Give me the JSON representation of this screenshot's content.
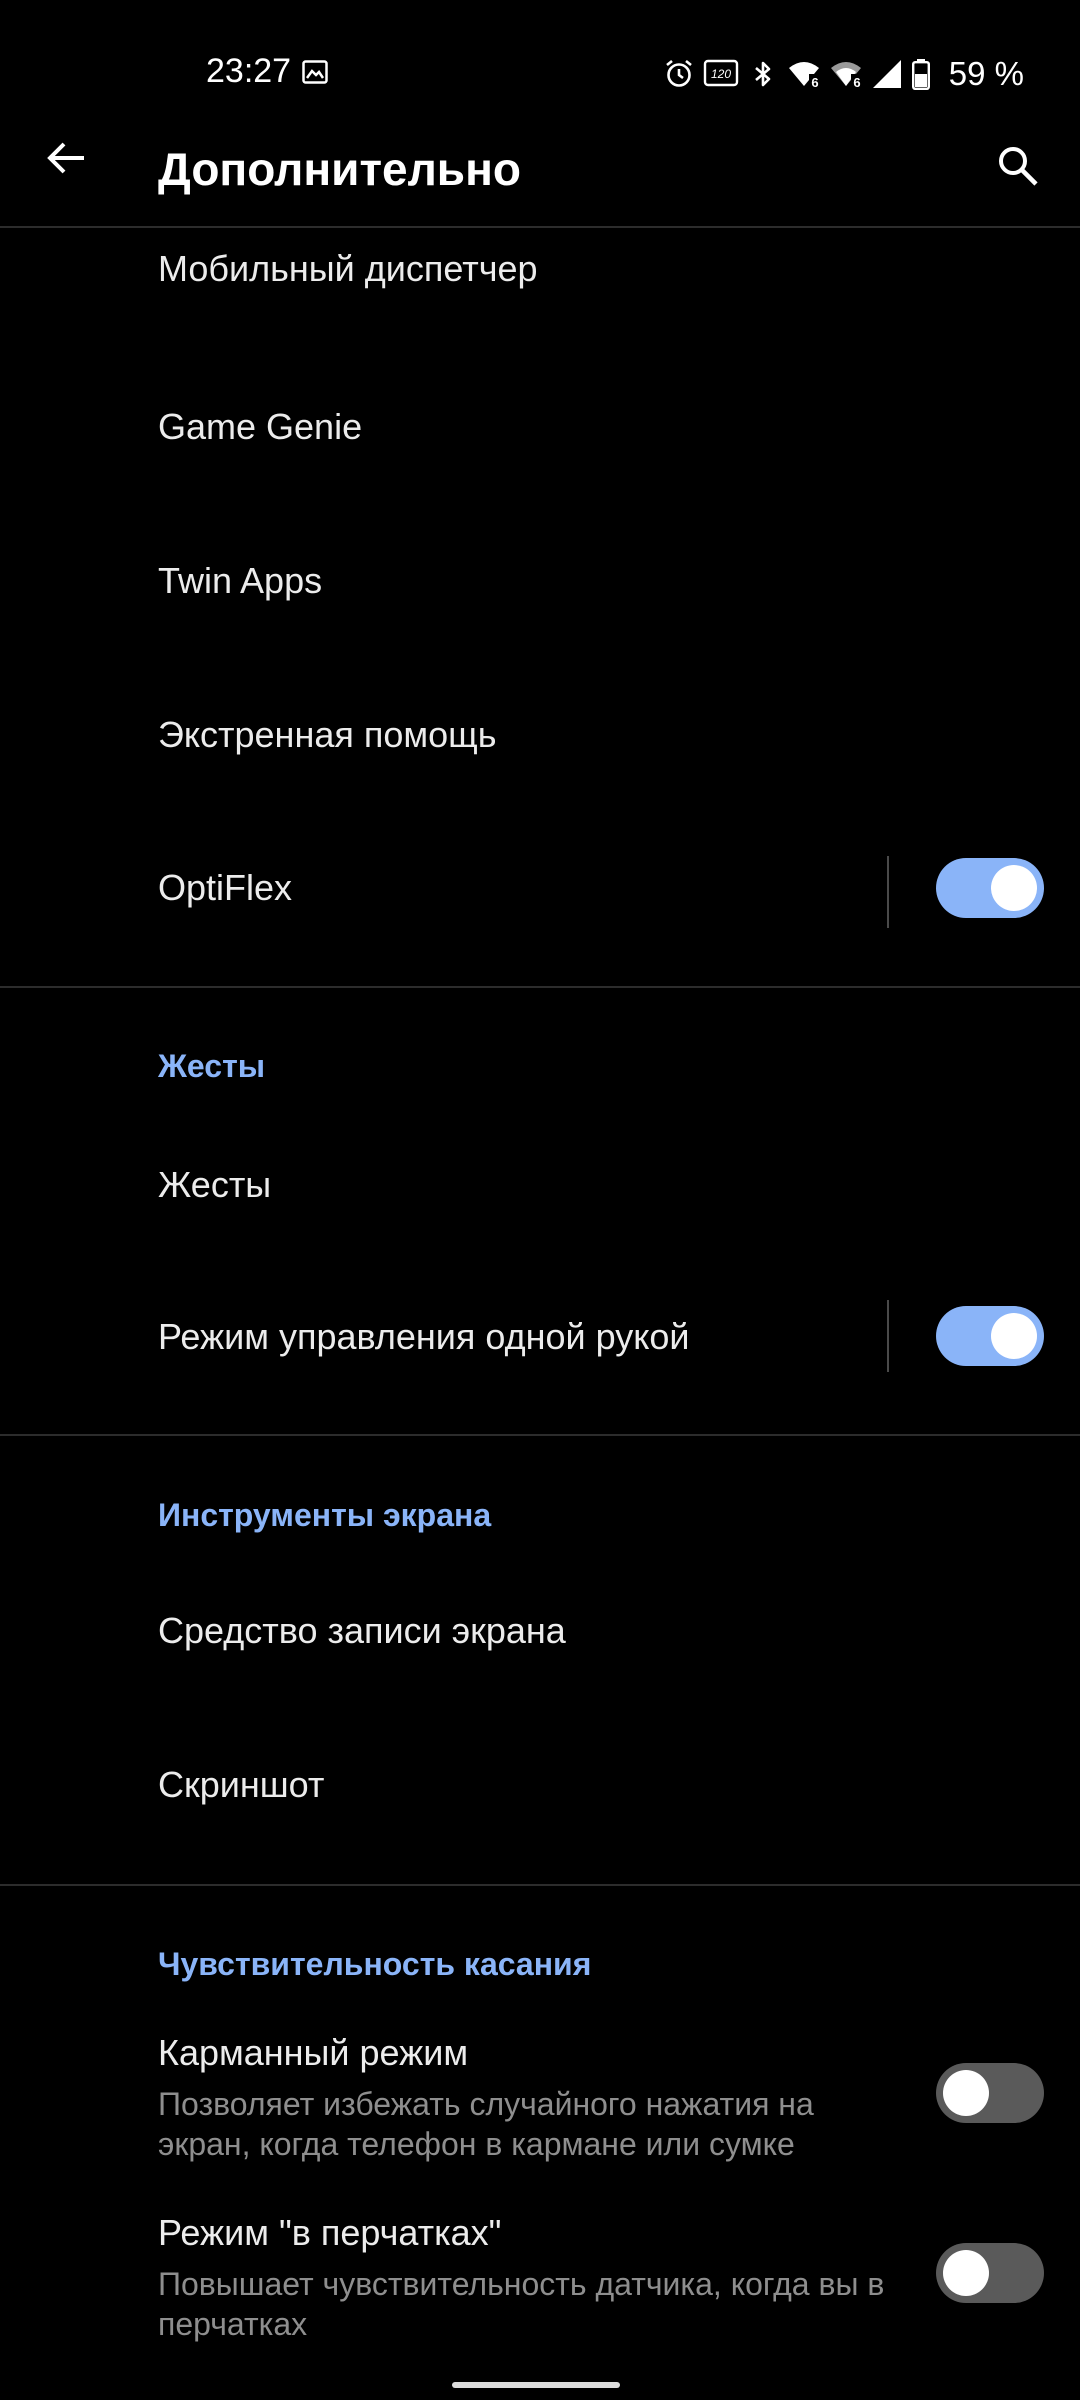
{
  "status_bar": {
    "time": "23:27",
    "battery_text": "59 %",
    "icons": [
      "gallery-icon",
      "alarm-icon",
      "refresh-rate-icon",
      "bluetooth-icon",
      "wifi-6-icon",
      "wifi-6-icon",
      "cell-signal-icon",
      "battery-icon"
    ],
    "refresh_rate_label": "120"
  },
  "app_bar": {
    "title": "Дополнительно",
    "back_icon": "arrow-left-icon",
    "search_icon": "search-icon"
  },
  "items_top": [
    {
      "title": "Мобильный диспетчер"
    },
    {
      "title": "Game Genie"
    },
    {
      "title": "Twin Apps"
    },
    {
      "title": "Экстренная помощь"
    },
    {
      "title": "OptiFlex",
      "toggle": true,
      "toggle_on": true
    }
  ],
  "sections": [
    {
      "header": "Жесты",
      "items": [
        {
          "title": "Жесты"
        },
        {
          "title": "Режим управления одной рукой",
          "toggle": true,
          "toggle_on": true
        }
      ]
    },
    {
      "header": "Инструменты экрана",
      "items": [
        {
          "title": "Средство записи экрана"
        },
        {
          "title": "Скриншот"
        }
      ]
    },
    {
      "header": "Чувствительность касания",
      "items": [
        {
          "title": "Карманный режим",
          "subtitle": "Позволяет избежать случайного нажатия на экран, когда телефон в кармане или сумке",
          "toggle": true,
          "toggle_on": false
        },
        {
          "title": "Режим \"в перчатках\"",
          "subtitle": "Повышает чувствительность датчика, когда вы в перчатках",
          "toggle": true,
          "toggle_on": false
        }
      ]
    }
  ],
  "colors": {
    "background": "#000000",
    "accent": "#8AB4F8",
    "text_primary": "#ECECEC",
    "text_secondary": "#8E8E8E",
    "divider": "#2C2C2C",
    "toggle_off": "#5A5A5A"
  }
}
